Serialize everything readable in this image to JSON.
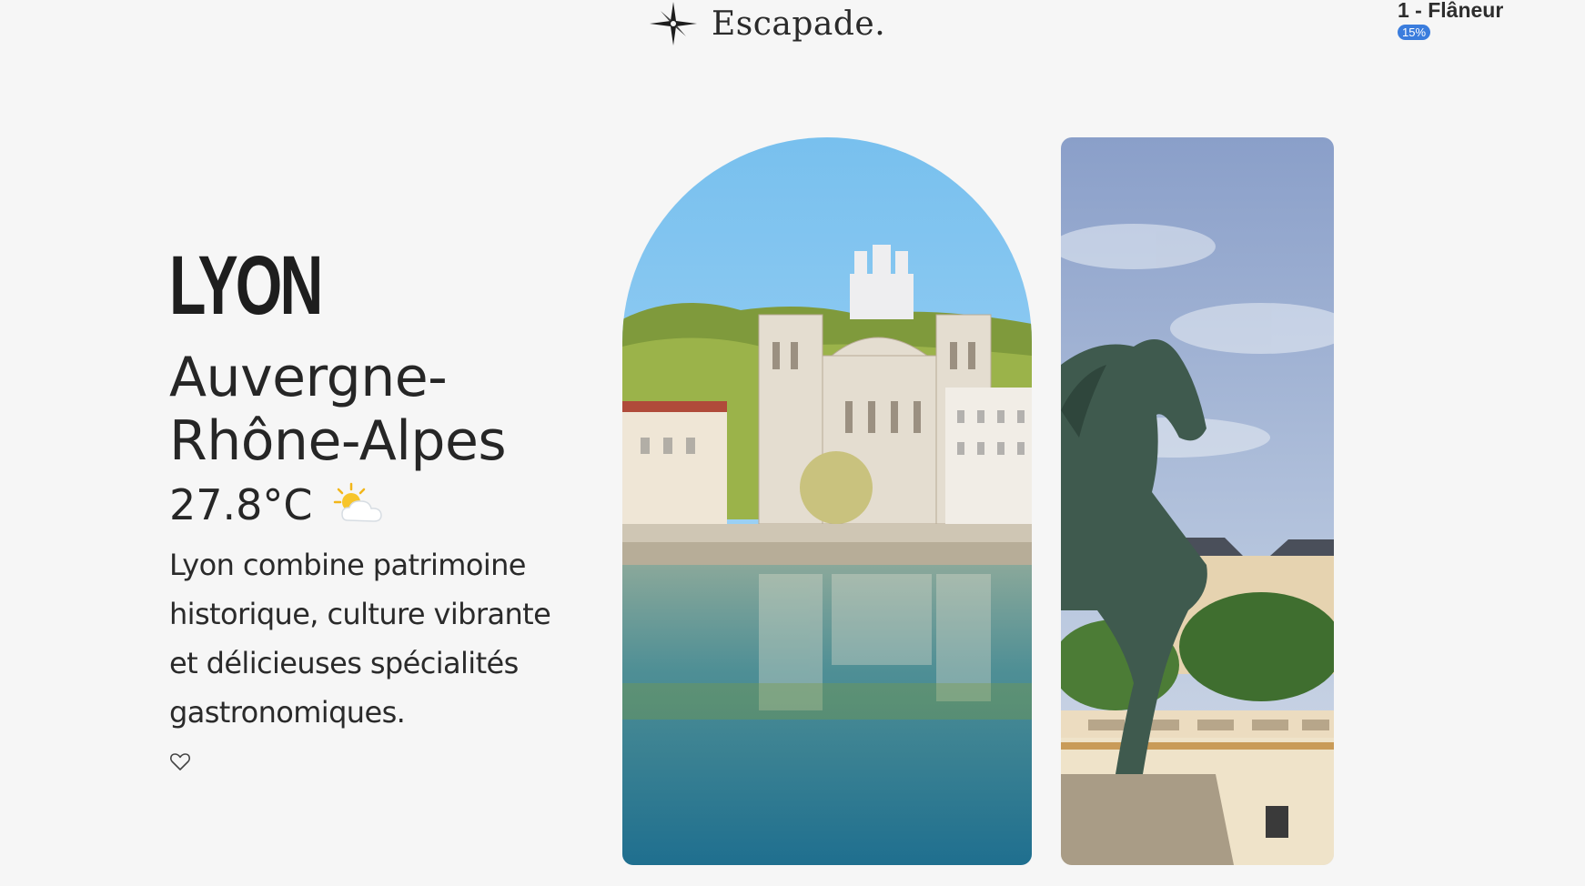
{
  "header": {
    "brand": "Escapade.",
    "logo_icon": "compass-star-icon"
  },
  "user": {
    "level": "1 - Flâneur",
    "progress_label": "15%",
    "progress": 0.15
  },
  "destination": {
    "city": "LYON",
    "region": "Auvergne-Rhône-Alpes",
    "temperature": "27.8°C",
    "weather_icon": "partly-sunny-icon",
    "description": "Lyon combine patrimoine historique, culture vibrante et délicieuses spécialités gastronomiques.",
    "favorite_icon": "heart-outline-icon"
  },
  "photos": [
    {
      "name": "lyon-cathedral-saone-photo"
    },
    {
      "name": "equestrian-statue-photo"
    }
  ],
  "colors": {
    "background": "#f6f6f6",
    "badge": "#3b7ddd",
    "sky": "#8fc9f0",
    "water": "#2f7f95"
  }
}
